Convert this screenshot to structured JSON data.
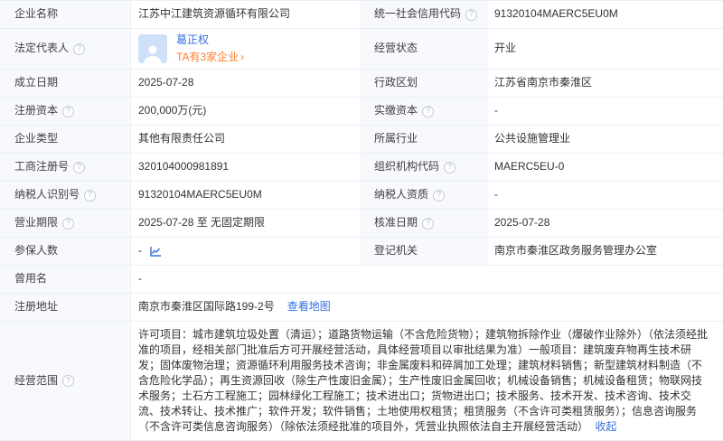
{
  "colors": {
    "link_blue": "#3470dc",
    "orange": "#ff7d2e",
    "label_bg": "#f7f9fc",
    "border": "#ebeff4",
    "text": "#333333",
    "avatar_bg": "#cfe1f9"
  },
  "icons": {
    "help": "?",
    "chevron_right": "›",
    "trend_chart": "line-chart",
    "person_avatar": "person-silhouette"
  },
  "fields": {
    "company_name": {
      "label": "企业名称",
      "value": "江苏中江建筑资源循环有限公司"
    },
    "credit_code": {
      "label": "统一社会信用代码",
      "value": "91320104MAERC5EU0M"
    },
    "legal_rep": {
      "label": "法定代表人",
      "name": "葛正权",
      "companies_link": "TA有3家企业"
    },
    "biz_status": {
      "label": "经营状态",
      "value": "开业"
    },
    "establish_date": {
      "label": "成立日期",
      "value": "2025-07-28"
    },
    "admin_division": {
      "label": "行政区划",
      "value": "江苏省南京市秦淮区"
    },
    "reg_capital": {
      "label": "注册资本",
      "value": "200,000万(元)"
    },
    "paid_capital": {
      "label": "实缴资本",
      "value": "-"
    },
    "company_type": {
      "label": "企业类型",
      "value": "其他有限责任公司"
    },
    "industry": {
      "label": "所属行业",
      "value": "公共设施管理业"
    },
    "reg_number": {
      "label": "工商注册号",
      "value": "320104000981891"
    },
    "org_code": {
      "label": "组织机构代码",
      "value": "MAERC5EU-0"
    },
    "taxpayer_id": {
      "label": "纳税人识别号",
      "value": "91320104MAERC5EU0M"
    },
    "taxpayer_quality": {
      "label": "纳税人资质",
      "value": "-"
    },
    "biz_term": {
      "label": "营业期限",
      "value": "2025-07-28 至 无固定期限"
    },
    "approval_date": {
      "label": "核准日期",
      "value": "2025-07-28"
    },
    "insured_count": {
      "label": "参保人数",
      "value": "-"
    },
    "reg_authority": {
      "label": "登记机关",
      "value": "南京市秦淮区政务服务管理办公室"
    },
    "former_name": {
      "label": "曾用名",
      "value": "-"
    },
    "reg_address": {
      "label": "注册地址",
      "value": "南京市秦淮区国际路199-2号",
      "map_link": "查看地图"
    },
    "biz_scope": {
      "label": "经营范围",
      "text": "许可项目：城市建筑垃圾处置（清运）；道路货物运输（不含危险货物）；建筑物拆除作业（爆破作业除外）（依法须经批准的项目，经相关部门批准后方可开展经营活动，具体经营项目以审批结果为准）一般项目：建筑废弃物再生技术研发；固体废物治理；资源循环利用服务技术咨询；非金属废料和碎屑加工处理；建筑材料销售；新型建筑材料制造（不含危险化学品）；再生资源回收（除生产性废旧金属）；生产性废旧金属回收；机械设备销售；机械设备租赁；物联网技术服务；土石方工程施工；园林绿化工程施工；技术进出口；货物进出口；技术服务、技术开发、技术咨询、技术交流、技术转让、技术推广；软件开发；软件销售；土地使用权租赁；租赁服务（不含许可类租赁服务）；信息咨询服务（不含许可类信息咨询服务）（除依法须经批准的项目外，凭营业执照依法自主开展经营活动）",
      "collapse_link": "收起"
    }
  }
}
